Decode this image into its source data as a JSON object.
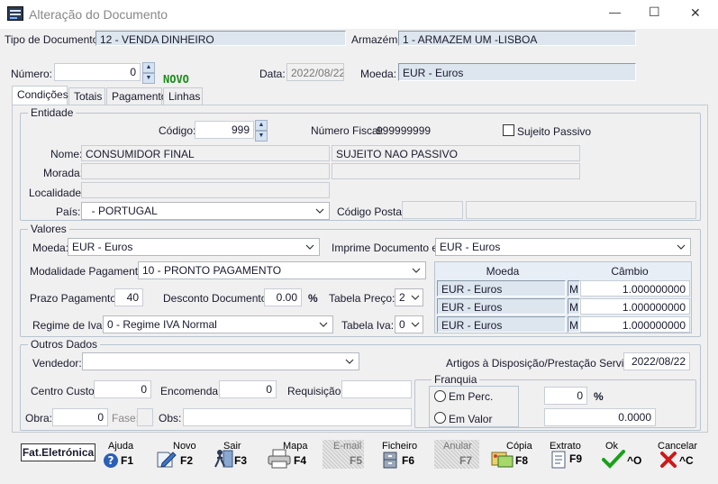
{
  "window": {
    "title": "Alteração do Documento",
    "minimize_glyph": "—",
    "maximize_glyph": "☐",
    "close_glyph": "✕"
  },
  "header": {
    "tipo_label": "Tipo de Documento:",
    "tipo_value": "12 - VENDA DINHEIRO",
    "armazem_label": "Armazém:",
    "armazem_value": "1 - ARMAZEM UM -LISBOA",
    "numero_label": "Número:",
    "numero_value": "0",
    "novo_badge": "NOVO",
    "data_label": "Data:",
    "data_value": "2022/08/22",
    "moeda_label": "Moeda:",
    "moeda_value": "EUR - Euros"
  },
  "tabs": [
    {
      "label": "Condições"
    },
    {
      "label": "Totais"
    },
    {
      "label": "Pagamento"
    },
    {
      "label": "Linhas"
    }
  ],
  "entidade": {
    "title": "Entidade",
    "codigo_label": "Código:",
    "codigo_value": "999",
    "nif_label": "Número Fiscal:",
    "nif_value": "999999999",
    "sujeito_label": "Sujeito Passivo",
    "nome_label": "Nome:",
    "nome_value": "CONSUMIDOR FINAL",
    "nome_extra": "SUJEITO NAO PASSIVO",
    "morada_label": "Morada:",
    "localidade_label": "Localidade:",
    "pais_label": "País:",
    "pais_value": "  - PORTUGAL",
    "cp_label": "Código Postal:"
  },
  "valores": {
    "title": "Valores",
    "moeda_label": "Moeda:",
    "moeda_value": "EUR - Euros",
    "imprime_label": "Imprime Documento em:",
    "imprime_value": "EUR - Euros",
    "modalidade_label": "Modalidade Pagamento:",
    "modalidade_value": "10 - PRONTO PAGAMENTO",
    "prazo_label": "Prazo Pagamento:",
    "prazo_value": "40",
    "desconto_label": "Desconto Documento:",
    "desconto_value": "0.00",
    "percent": "%",
    "tabela_preco_label": "Tabela Preço:",
    "tabela_preco_value": "2",
    "regime_label": "Regime de Iva:",
    "regime_value": "0 - Regime IVA Normal",
    "tabela_iva_label": "Tabela Iva:",
    "tabela_iva_value": "0",
    "cambio_table": {
      "col_moeda": "Moeda",
      "col_cambio": "Câmbio",
      "rows": [
        {
          "moeda": "EUR - Euros",
          "flag": "M",
          "cambio": "1.000000000"
        },
        {
          "moeda": "EUR - Euros",
          "flag": "M",
          "cambio": "1.000000000"
        },
        {
          "moeda": "EUR - Euros",
          "flag": "M",
          "cambio": "1.000000000"
        }
      ]
    }
  },
  "outros": {
    "title": "Outros Dados",
    "vendedor_label": "Vendedor:",
    "artigos_label": "Artigos à Disposição/Prestação Serviços",
    "artigos_value": "2022/08/22",
    "centro_label": "Centro Custo:",
    "centro_value": "0",
    "encomenda_label": "Encomenda:",
    "encomenda_value": "0",
    "requisicao_label": "Requisição:",
    "obra_label": "Obra:",
    "obra_value": "0",
    "fase_label": "Fase:",
    "obs_label": "Obs:",
    "franquia_title": "Franquia",
    "em_perc_label": "Em Perc.",
    "em_valor_label": "Em Valor",
    "perc_value": "0",
    "perc_sign": "%",
    "valor_value": "0.0000"
  },
  "toolbar": {
    "fat_label": "Fat.Eletrónica",
    "ajuda_label": "Ajuda",
    "ajuda_key": "F1",
    "novo_label": "Novo",
    "novo_key": "F2",
    "sair_label": "Sair",
    "sair_key": "F3",
    "mapa_label": "Mapa",
    "mapa_key": "F4",
    "email_label": "E-mail",
    "email_key": "F5",
    "ficheiro_label": "Ficheiro",
    "ficheiro_key": "F6",
    "anular_label": "Anular",
    "anular_key": "F7",
    "copia_label": "Cópia",
    "copia_key": "F8",
    "extrato_label": "Extrato",
    "extrato_key": "F9",
    "ok_label": "Ok",
    "ok_key": "^O",
    "cancelar_label": "Cancelar",
    "cancelar_key": "^C"
  }
}
